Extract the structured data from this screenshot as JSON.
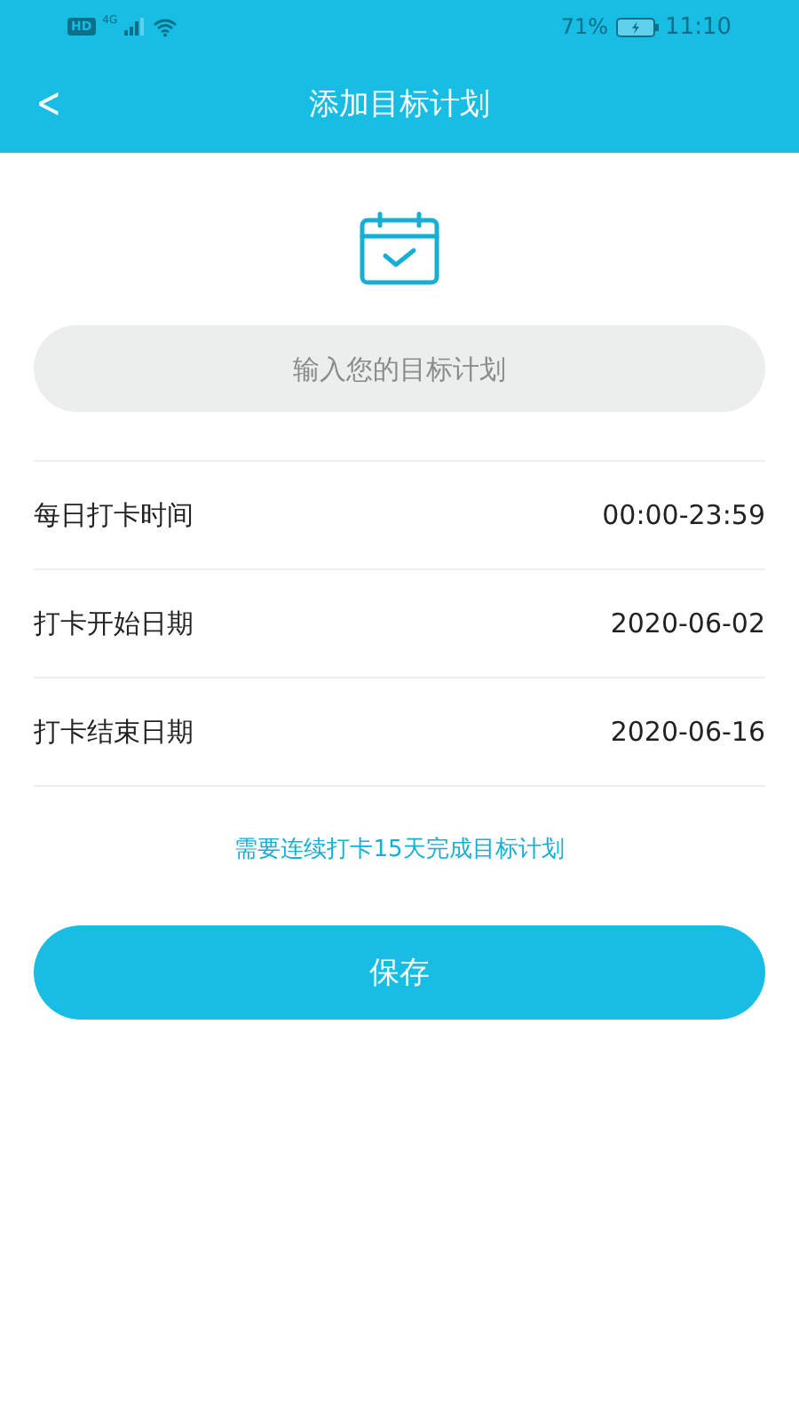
{
  "status_bar": {
    "hd": "HD",
    "network": "4G",
    "battery_percent": "71%",
    "time": "11:10"
  },
  "header": {
    "back": "<",
    "title": "添加目标计划"
  },
  "goal_input": {
    "placeholder": "输入您的目标计划"
  },
  "settings": [
    {
      "label": "每日打卡时间",
      "value": "00:00-23:59"
    },
    {
      "label": "打卡开始日期",
      "value": "2020-06-02"
    },
    {
      "label": "打卡结束日期",
      "value": "2020-06-16"
    }
  ],
  "note": "需要连续打卡15天完成目标计划",
  "save_button": "保存"
}
